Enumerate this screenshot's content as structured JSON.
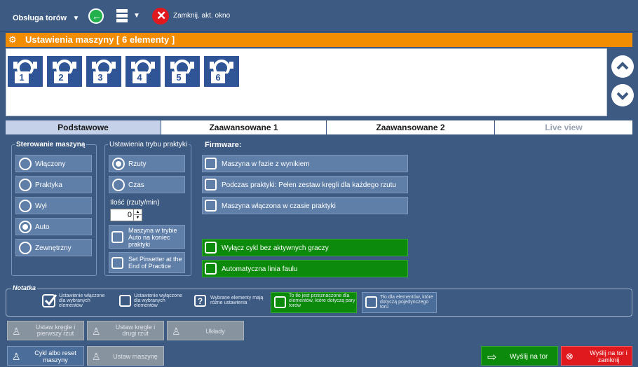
{
  "topbar": {
    "menu_label": "Obsługa torów",
    "close_label": "Zamknij. akt. okno"
  },
  "title": "Ustawienia maszyny [ 6 elementy ]",
  "tiles": [
    "1",
    "2",
    "3",
    "4",
    "5",
    "6"
  ],
  "tabs": [
    "Podstawowe",
    "Zaawansowane 1",
    "Zaawansowane 2",
    "Live view"
  ],
  "sterowanie": {
    "title": "Sterowanie maszyną",
    "options": [
      "Włączony",
      "Praktyka",
      "Wył",
      "Auto",
      "Zewnętrzny"
    ],
    "selected": "Auto"
  },
  "tryb": {
    "title": "Ustawienia trybu praktyki",
    "options": [
      "Rzuty",
      "Czas"
    ],
    "selected": "Rzuty",
    "ilosc_label": "Ilość (rzuty/min)",
    "ilosc_value": "0",
    "check1": "Maszyna w trybie Auto na koniec praktyki",
    "check2": "Set Pinsetter at the End of Practice"
  },
  "firmware": {
    "title": "Firmware:",
    "items": [
      "Maszyna w fazie z wynikiem",
      "Podczas praktyki: Pełen zestaw kręgli dla każdego rzutu",
      "Maszyna włączona w czasie praktyki"
    ],
    "green_items": [
      "Wyłącz cykl bez aktywnych graczy",
      "Automatyczna linia faulu"
    ]
  },
  "notka": {
    "title": "Notatka",
    "items": [
      "Ustawienie włączone dla wybranych elementów",
      "Ustawienie wyłączone dla wybranych elementów",
      "Wybrane elementy mają różne ustawienia",
      "To tło jest przeznaczone dla elementów, które dotyczą pary torów",
      "Tło dla elementów, które dotyczą pojedynczego toru"
    ]
  },
  "bottom": {
    "b1": "Ustaw kręgle i pierwszy rzut",
    "b2": "Ustaw kręgle i drugi rzut",
    "b3": "Układy",
    "b4": "Cykl albo reset maszyny",
    "b5": "Ustaw maszynę",
    "send": "Wyślij na tor",
    "send_close": "Wyślij na tor i zamknij"
  },
  "colors": {
    "background": "#3c5a82",
    "title_bar": "#f28c00",
    "tile": "#2f5597",
    "green": "#0c8a0c",
    "red": "#e0191e"
  }
}
